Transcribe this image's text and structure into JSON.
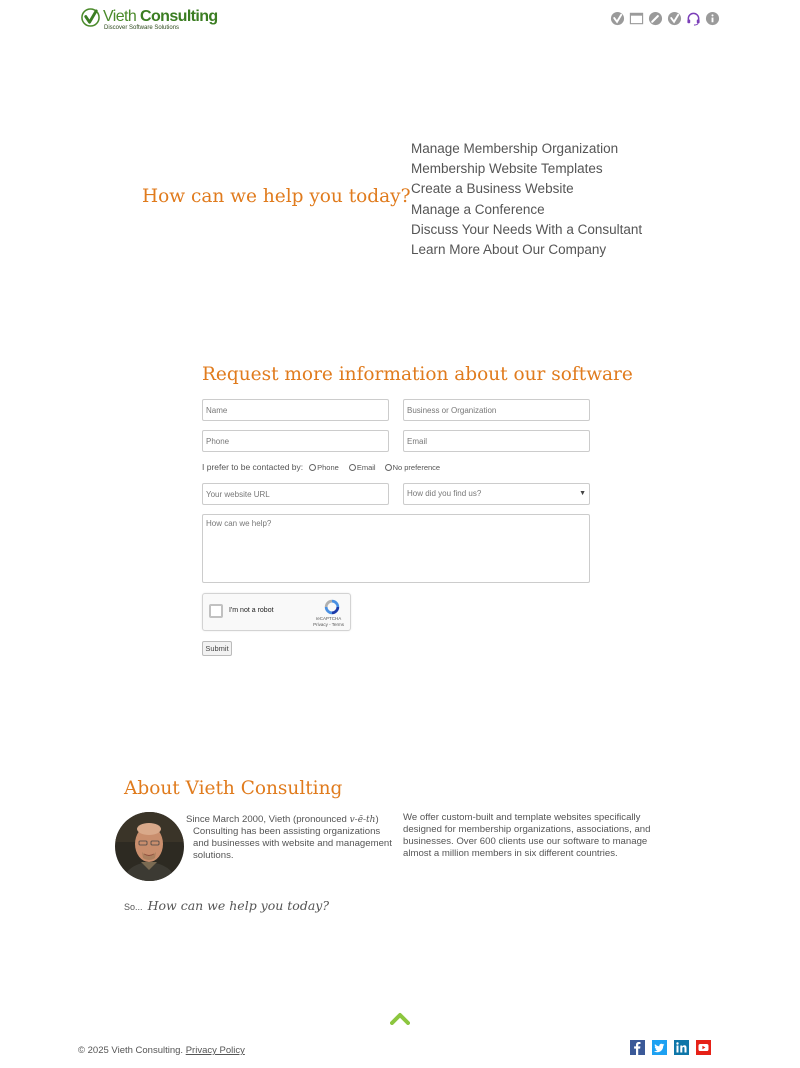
{
  "header": {
    "brand_first": "Vieth",
    "brand_second": "Consulting",
    "tagline": "Discover Software Solutions",
    "icons": [
      "membership-check-icon",
      "window-icon",
      "pencil-circle-icon",
      "checkmark-circle-icon",
      "headset-icon",
      "info-icon"
    ]
  },
  "help": {
    "heading": "How can we help you today?",
    "links": [
      "Manage Membership Organization",
      "Membership Website Templates",
      "Create a Business Website",
      "Manage a Conference",
      "Discuss Your Needs With a Consultant",
      "Learn More About Our Company"
    ]
  },
  "form": {
    "heading": "Request more information about our software",
    "name_placeholder": "Name",
    "org_placeholder": "Business or Organization",
    "phone_placeholder": "Phone",
    "email_placeholder": "Email",
    "contact_label": "I prefer to be contacted by:",
    "contact_options": [
      "Phone",
      "Email",
      "No preference"
    ],
    "website_placeholder": "Your website URL",
    "source_select": "How did you find us?",
    "message_placeholder": "How can we help?",
    "captcha_label": "I'm not a robot",
    "captcha_brand": "reCAPTCHA",
    "captcha_links": "Privacy - Terms",
    "submit_label": "Submit"
  },
  "about": {
    "heading": "About Vieth Consulting",
    "left_line1_a": "Since March 2000, Vieth (pronounced ",
    "left_pron": "v-ē-th",
    "left_line1_b": ")",
    "left_line2": "Consulting has been assisting organizations",
    "left_line3": "and businesses with website and management",
    "left_line4": "solutions.",
    "right_line1": "We offer custom-built and template websites specifically",
    "right_line2": "designed for membership organizations, associations, and",
    "right_line3": "businesses. Over 600 clients use our software to manage",
    "right_line4": "almost a million members in six different countries.",
    "so_prefix": "So...",
    "so_question": "How can we help you today?"
  },
  "footer": {
    "copyright": "© 2025 Vieth Consulting.",
    "privacy_link": "Privacy Policy",
    "social": [
      "facebook-icon",
      "twitter-icon",
      "linkedin-icon",
      "youtube-icon"
    ]
  },
  "colors": {
    "accent_orange": "#e07b1d",
    "brand_green": "#3b7d22",
    "scroll_up_green": "#8cc63f",
    "facebook": "#3b5998",
    "twitter": "#1da1f2",
    "linkedin": "#0e76a8",
    "youtube": "#e62117"
  }
}
